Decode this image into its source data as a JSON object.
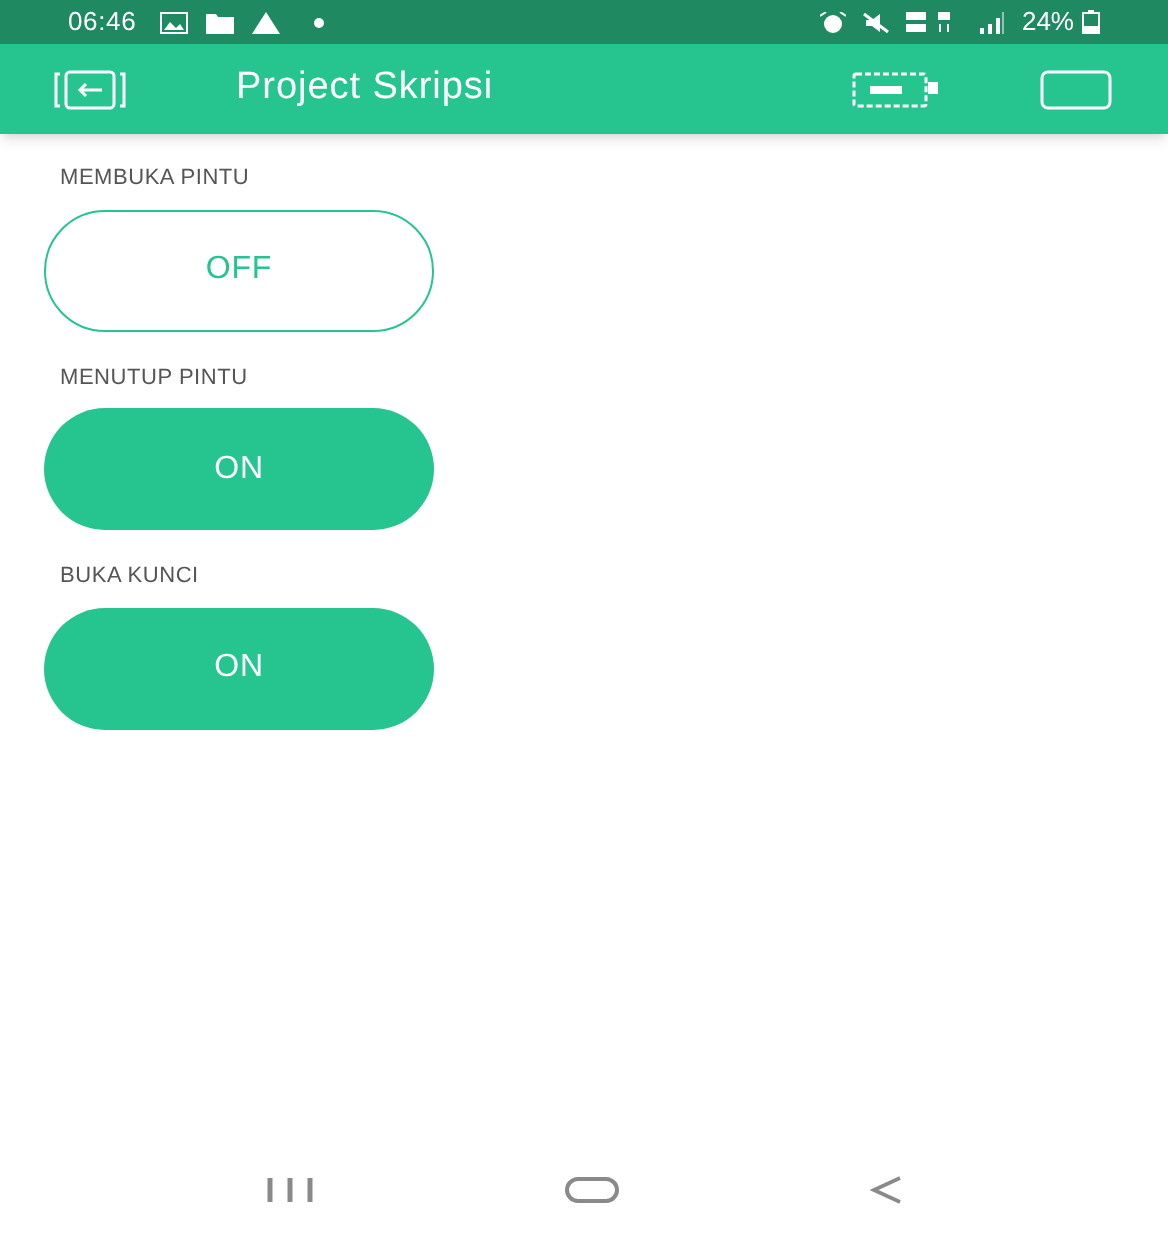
{
  "status_bar": {
    "time": "06:46",
    "battery": "24%"
  },
  "app_bar": {
    "title": "Project Skripsi"
  },
  "switches": [
    {
      "label": "MEMBUKA PINTU",
      "text": "OFF",
      "on": false
    },
    {
      "label": "MENUTUP PINTU",
      "text": "ON",
      "on": true
    },
    {
      "label": "BUKA KUNCI",
      "text": "ON",
      "on": true
    }
  ]
}
